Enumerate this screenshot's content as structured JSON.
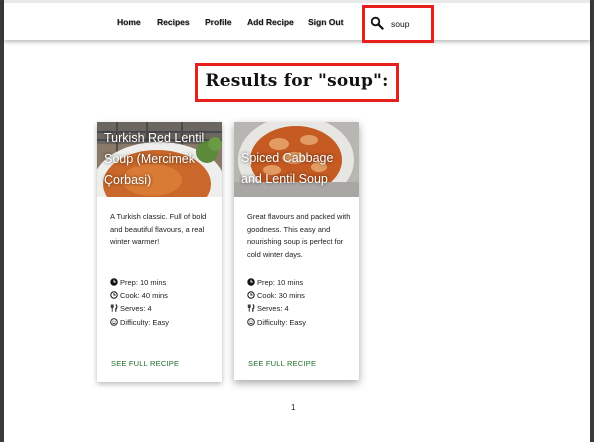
{
  "nav": {
    "links": [
      "Home",
      "Recipes",
      "Profile",
      "Add Recipe",
      "Sign Out"
    ],
    "search_value": "soup",
    "search_icon": "search-icon"
  },
  "page": {
    "heading": "Results for \"soup\":"
  },
  "recipes": [
    {
      "title": "Turkish Red Lentil Soup (Mercimek Çorbasi)",
      "description": "A Turkish classic. Full of bold and beautiful flavours, a real winter warmer!",
      "prep": "Prep: 10 mins",
      "cook": "Cook: 40 mins",
      "serves": "Serves: 4",
      "difficulty": "Difficulty: Easy",
      "link": "SEE FULL RECIPE"
    },
    {
      "title": "Spiced Cabbage and Lentil Soup",
      "description": "Great flavours and packed with goodness. This easy and nourishing soup is perfect for cold winter days.",
      "prep": "Prep: 10 mins",
      "cook": "Cook: 30 mins",
      "serves": "Serves: 4",
      "difficulty": "Difficulty: Easy",
      "link": "SEE FULL RECIPE"
    }
  ],
  "pagination": {
    "current": "1"
  },
  "colors": {
    "highlight_border": "#e8201c",
    "link": "#1e6b2a"
  }
}
